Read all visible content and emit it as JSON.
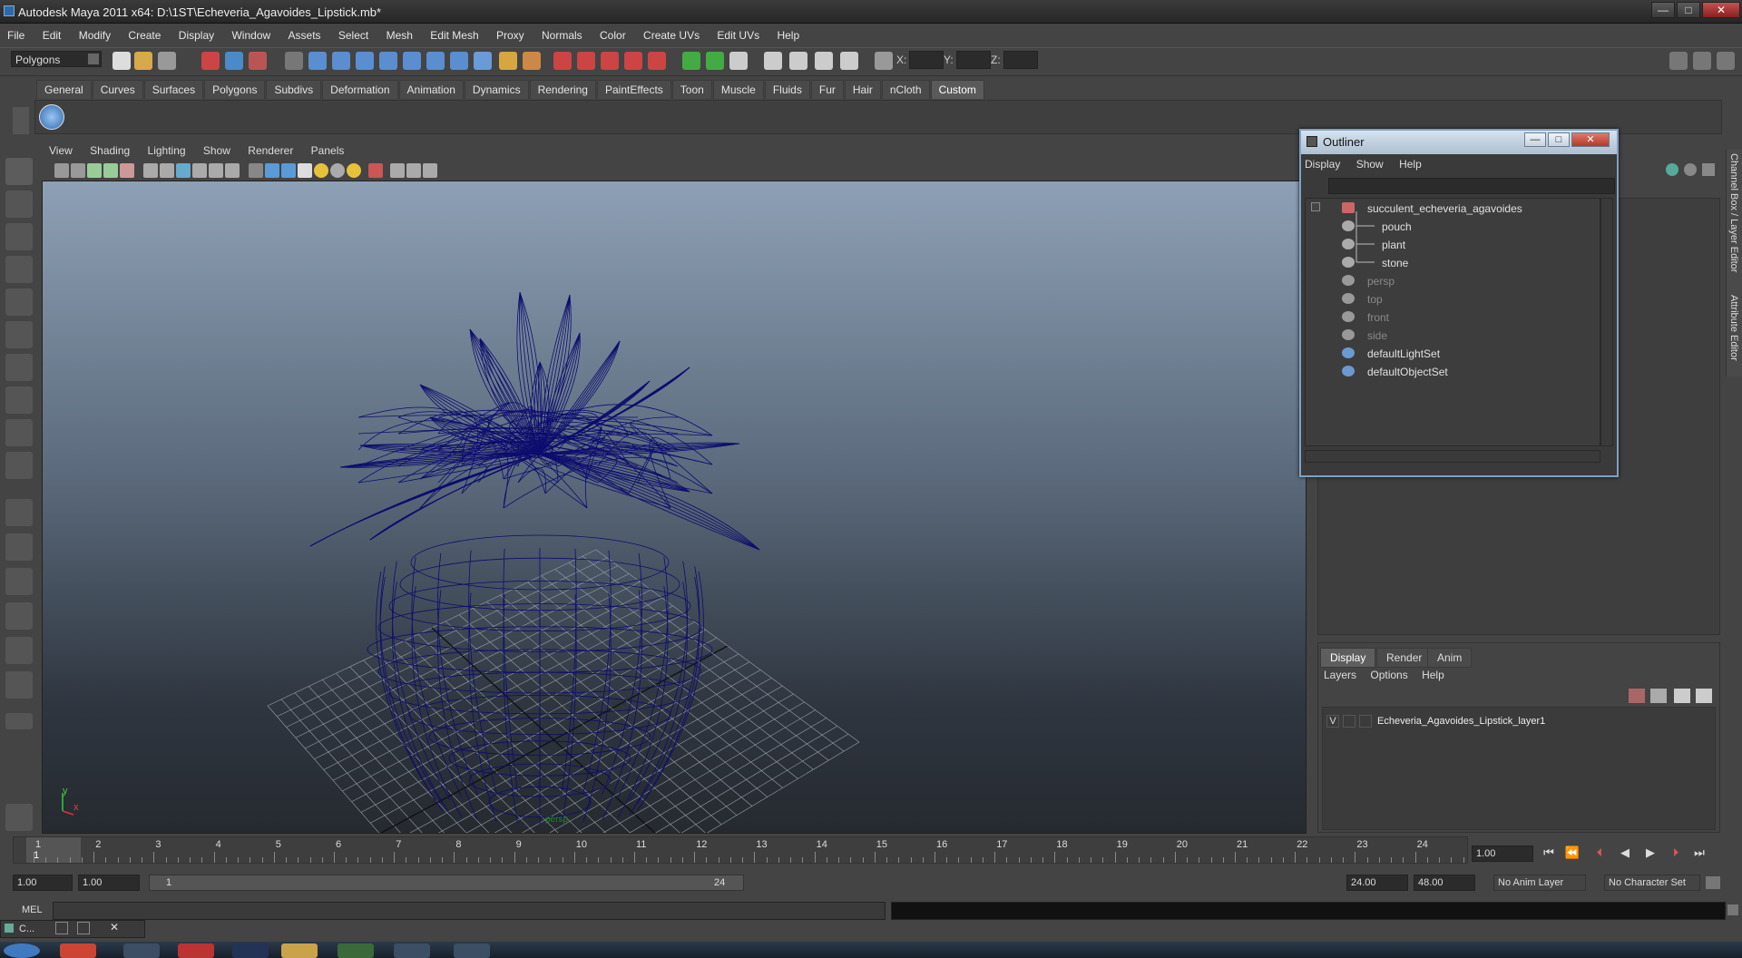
{
  "window": {
    "title": "Autodesk Maya 2011 x64: D:\\1ST\\Echeveria_Agavoides_Lipstick.mb*",
    "minimize": "—",
    "maximize": "□",
    "close": "✕"
  },
  "menubar": [
    "File",
    "Edit",
    "Modify",
    "Create",
    "Display",
    "Window",
    "Assets",
    "Select",
    "Mesh",
    "Edit Mesh",
    "Proxy",
    "Normals",
    "Color",
    "Create UVs",
    "Edit UVs",
    "Help"
  ],
  "status_line": {
    "mode": "Polygons",
    "x_label": "X:",
    "y_label": "Y:",
    "z_label": "Z:"
  },
  "shelf_tabs": [
    "General",
    "Curves",
    "Surfaces",
    "Polygons",
    "Subdivs",
    "Deformation",
    "Animation",
    "Dynamics",
    "Rendering",
    "PaintEffects",
    "Toon",
    "Muscle",
    "Fluids",
    "Fur",
    "Hair",
    "nCloth",
    "Custom"
  ],
  "shelf_active": "Custom",
  "viewport": {
    "menu": [
      "View",
      "Shading",
      "Lighting",
      "Show",
      "Renderer",
      "Panels"
    ],
    "camera_label": "persp",
    "axis_x": "x",
    "axis_y": "y",
    "wire_color": "#0d0d6e"
  },
  "right_tabs": [
    "Channel Box / Layer Editor",
    "Attribute Editor"
  ],
  "outliner": {
    "title": "Outliner",
    "menu": [
      "Display",
      "Show",
      "Help"
    ],
    "items": [
      {
        "label": "succulent_echeveria_agavoides",
        "dim": false,
        "depth": 0
      },
      {
        "label": "pouch",
        "dim": false,
        "depth": 1
      },
      {
        "label": "plant",
        "dim": false,
        "depth": 1
      },
      {
        "label": "stone",
        "dim": false,
        "depth": 1
      },
      {
        "label": "persp",
        "dim": true,
        "depth": 0
      },
      {
        "label": "top",
        "dim": true,
        "depth": 0
      },
      {
        "label": "front",
        "dim": true,
        "depth": 0
      },
      {
        "label": "side",
        "dim": true,
        "depth": 0
      },
      {
        "label": "defaultLightSet",
        "dim": false,
        "depth": 0
      },
      {
        "label": "defaultObjectSet",
        "dim": false,
        "depth": 0
      }
    ]
  },
  "layer_editor": {
    "tabs": [
      "Display",
      "Render",
      "Anim"
    ],
    "menu": [
      "Layers",
      "Options",
      "Help"
    ],
    "layer_visibility": "V",
    "layer_name": "Echeveria_Agavoides_Lipstick_layer1"
  },
  "time_slider": {
    "ticks": [
      "1",
      "2",
      "3",
      "4",
      "5",
      "6",
      "7",
      "8",
      "9",
      "10",
      "11",
      "12",
      "13",
      "14",
      "15",
      "16",
      "17",
      "18",
      "19",
      "20",
      "21",
      "22",
      "23",
      "24"
    ],
    "current_frame_marker": "1",
    "current_time": "1.00"
  },
  "range": {
    "start": "1.00",
    "playback_start": "1.00",
    "slider_start": "1",
    "slider_end": "24",
    "playback_end": "24.00",
    "end": "48.00",
    "anim_layer": "No Anim Layer",
    "character_set": "No Character Set"
  },
  "mel": {
    "label": "MEL"
  },
  "bottom_window": {
    "label": "C..."
  }
}
